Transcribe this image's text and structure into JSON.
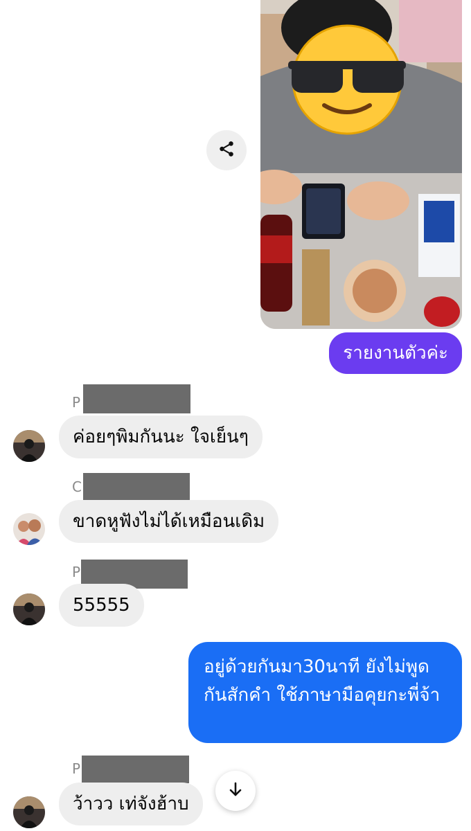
{
  "messages": {
    "photo": {
      "name": "shared-photo"
    },
    "outgoing_1": {
      "text": "รายงานตัวค่ะ"
    },
    "incoming_1": {
      "sender_initial": "P",
      "text": "ค่อยๆพิมกันนะ ใจเย็นๆ"
    },
    "incoming_2": {
      "sender_initial": "C",
      "text": "ขาดหูฟังไม่ได้เหมือนเดิม"
    },
    "incoming_3": {
      "sender_initial": "P",
      "text": "55555"
    },
    "outgoing_2": {
      "text": "อยู่ด้วยกันมา30นาที ยังไม่พูดกันสักคำ ใช้ภาษามือคุยกะพี่จ้า"
    },
    "incoming_4": {
      "sender_initial": "P",
      "text": "ว้าวว เท่จังฮ้าบ"
    }
  },
  "icons": {
    "share": "share-icon",
    "scroll_down": "arrow-down-icon"
  },
  "colors": {
    "purple_bubble": "#6b3cf0",
    "blue_bubble": "#1a6ef5",
    "incoming_bubble": "#eeeeee",
    "redaction": "#6b6b6b"
  }
}
